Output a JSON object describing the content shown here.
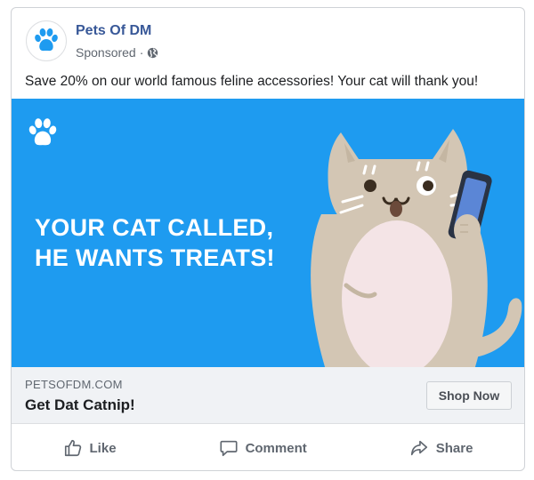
{
  "post": {
    "page_name": "Pets Of DM",
    "sponsored_label": "Sponsored",
    "separator": "·",
    "audience_icon": "globe-icon",
    "avatar_icon": "paw-icon",
    "text": "Save 20% on our world famous feline accessories! Your cat will thank you!"
  },
  "creative": {
    "headline_line1": "YOUR CAT CALLED,",
    "headline_line2": "HE WANTS TREATS!",
    "background_color": "#1e9bf0",
    "brand_icon": "paw-icon",
    "illustration": "cat-with-phone"
  },
  "link": {
    "domain": "PETSOFDM.COM",
    "title": "Get Dat Catnip!",
    "cta_label": "Shop Now"
  },
  "actions": {
    "like_label": "Like",
    "comment_label": "Comment",
    "share_label": "Share"
  },
  "colors": {
    "brand_blue": "#385898",
    "paw_blue": "#1e9bf0",
    "secondary_text": "#606770"
  }
}
